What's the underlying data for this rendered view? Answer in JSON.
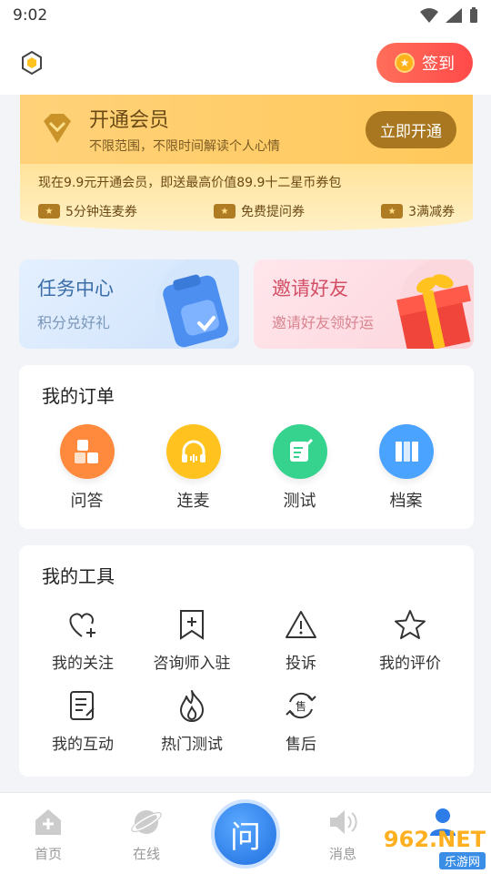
{
  "status_bar": {
    "time": "9:02"
  },
  "header": {
    "signin_label": "签到"
  },
  "member": {
    "title": "开通会员",
    "subtitle": "不限范围，不限时间解读个人心情",
    "button": "立即开通",
    "promo": "现在9.9元开通会员，即送最高价值89.9十二星币券包",
    "coupons": [
      "5分钟连麦券",
      "免费提问券",
      "3满减券"
    ]
  },
  "quick": {
    "task": {
      "title": "任务中心",
      "subtitle": "积分兑好礼"
    },
    "invite": {
      "title": "邀请好友",
      "subtitle": "邀请好友领好运"
    }
  },
  "orders": {
    "title": "我的订单",
    "items": [
      {
        "label": "问答",
        "color": "#ff8a3d"
      },
      {
        "label": "连麦",
        "color": "#ffc21f"
      },
      {
        "label": "测试",
        "color": "#36d38f"
      },
      {
        "label": "档案",
        "color": "#4aa3ff"
      }
    ]
  },
  "tools": {
    "title": "我的工具",
    "items": [
      {
        "label": "我的关注",
        "icon": "heart-plus-icon"
      },
      {
        "label": "咨询师入驻",
        "icon": "bookmark-plus-icon"
      },
      {
        "label": "投诉",
        "icon": "warning-icon"
      },
      {
        "label": "我的评价",
        "icon": "star-icon"
      },
      {
        "label": "我的互动",
        "icon": "document-icon"
      },
      {
        "label": "热门测试",
        "icon": "flame-icon"
      },
      {
        "label": "售后",
        "icon": "after-sales-icon"
      }
    ]
  },
  "tabbar": {
    "home": "首页",
    "online": "在线",
    "ask": "问",
    "messages": "消息"
  },
  "watermark": {
    "brand": "962.NET",
    "site": "乐游网"
  }
}
